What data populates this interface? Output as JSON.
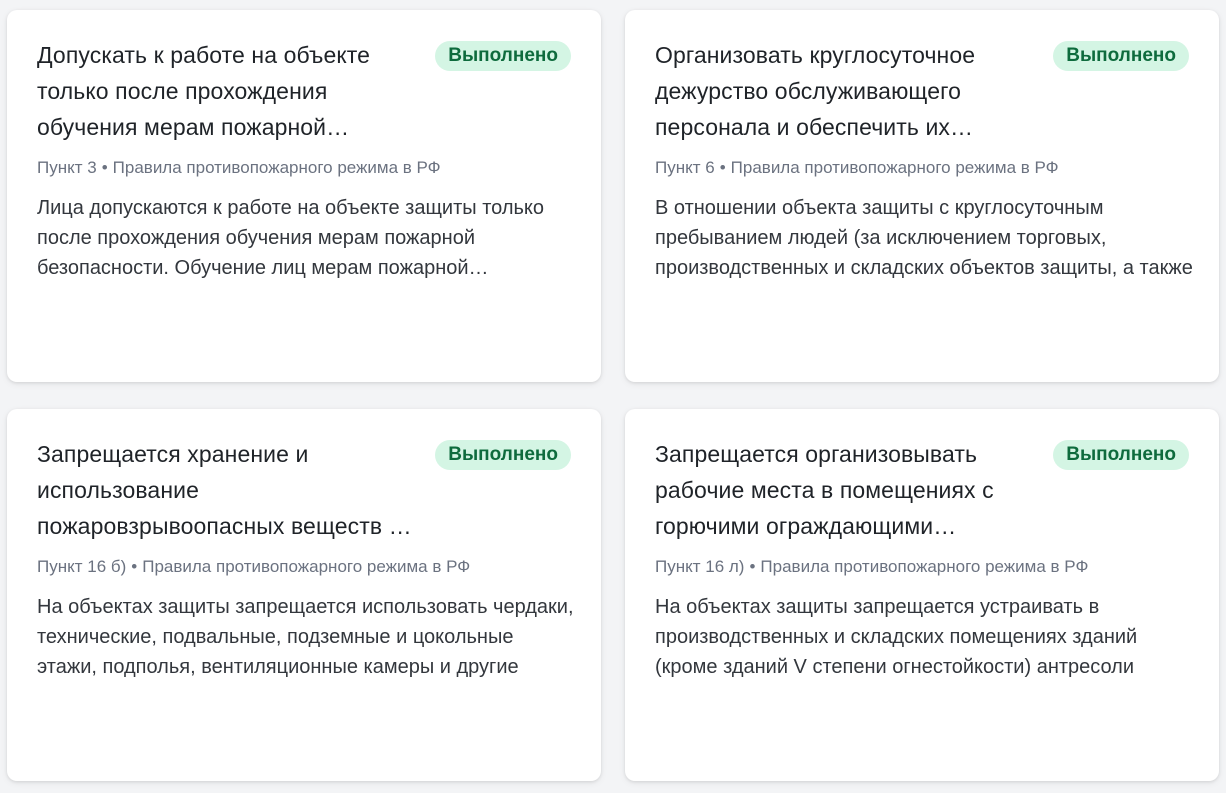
{
  "cards": [
    {
      "title": "Допускать к работе на объекте только после прохождения обучения мерам пожарной безопасности",
      "status": "Выполнено",
      "point": "Пункт 3",
      "separator": "•",
      "source": "Правила противопожарного режима в РФ",
      "description": "Лица допускаются к работе на объекте защиты только после прохождения обучения мерам пожарной безопасности. Обучение лиц мерам пожарной безопасности осуществляется"
    },
    {
      "title": "Организовать круглосуточное дежурство обслуживающего персонала и обеспечить их средствами",
      "status": "Выполнено",
      "point": "Пункт 6",
      "separator": "•",
      "source": "Правила противопожарного режима в РФ",
      "description": "В отношении объекта защиты с круглосуточным пребыванием людей (за исключением торговых, производственных и складских объектов защиты, а также"
    },
    {
      "title": "Запрещается хранение и использование пожаровзрывоопасных веществ и материалов",
      "status": "Выполнено",
      "point": "Пункт 16 б)",
      "separator": "•",
      "source": "Правила противопожарного режима в РФ",
      "description": "На объектах защиты запрещается использовать чердаки, технические, подвальные, подземные и цокольные этажи, подполья, вентиляционные камеры и другие"
    },
    {
      "title": "Запрещается организовывать рабочие места в помещениях с горючими ограждающими конструкциями",
      "status": "Выполнено",
      "point": "Пункт 16 л)",
      "separator": "•",
      "source": "Правила противопожарного режима в РФ",
      "description": "На объектах защиты запрещается устраивать в производственных и складских помещениях зданий (кроме зданий V степени огнестойкости) антресоли"
    }
  ],
  "colors": {
    "badge_bg": "#d4f5e4",
    "badge_text": "#0e6b3d",
    "title_text": "#1f2328",
    "meta_text": "#6b7280"
  }
}
